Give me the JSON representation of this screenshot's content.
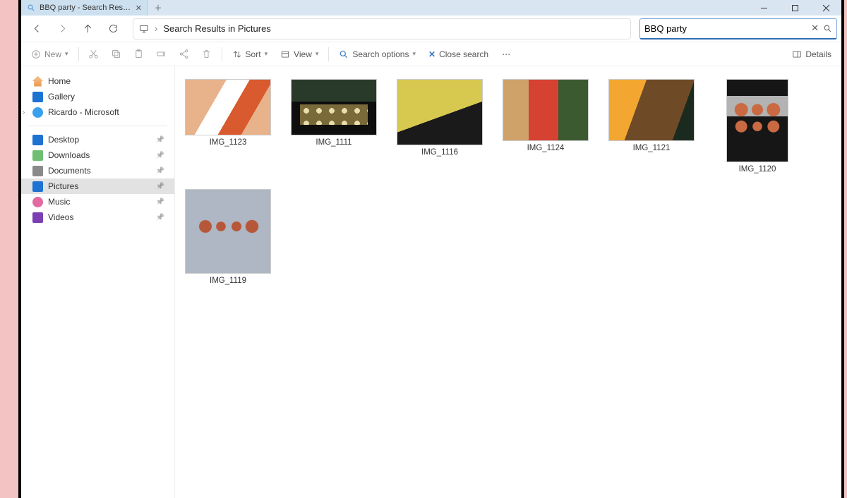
{
  "tab": {
    "title": "BBQ party - Search Results in Pictures"
  },
  "address": {
    "label": "Search Results in Pictures"
  },
  "search": {
    "value": "BBQ party"
  },
  "toolbar": {
    "new": "New",
    "sort": "Sort",
    "view": "View",
    "searchOptions": "Search options",
    "closeSearch": "Close search",
    "details": "Details"
  },
  "sidebar": {
    "top": [
      {
        "label": "Home",
        "icon": "home"
      },
      {
        "label": "Gallery",
        "icon": "gallery"
      },
      {
        "label": "Ricardo - Microsoft",
        "icon": "cloud",
        "expandable": true
      }
    ],
    "quick": [
      {
        "label": "Desktop",
        "icon": "desktop",
        "pinned": true
      },
      {
        "label": "Downloads",
        "icon": "downloads",
        "pinned": true
      },
      {
        "label": "Documents",
        "icon": "documents",
        "pinned": true
      },
      {
        "label": "Pictures",
        "icon": "pictures",
        "pinned": true,
        "active": true
      },
      {
        "label": "Music",
        "icon": "music",
        "pinned": true
      },
      {
        "label": "Videos",
        "icon": "videos",
        "pinned": true
      }
    ]
  },
  "results": [
    {
      "name": "IMG_1123",
      "thumb": "t0"
    },
    {
      "name": "IMG_1111",
      "thumb": "t1"
    },
    {
      "name": "IMG_1116",
      "thumb": "t2"
    },
    {
      "name": "IMG_1124",
      "thumb": "t3"
    },
    {
      "name": "IMG_1121",
      "thumb": "t4"
    },
    {
      "name": "IMG_1120",
      "thumb": "t5"
    },
    {
      "name": "IMG_1119",
      "thumb": "t6"
    }
  ]
}
